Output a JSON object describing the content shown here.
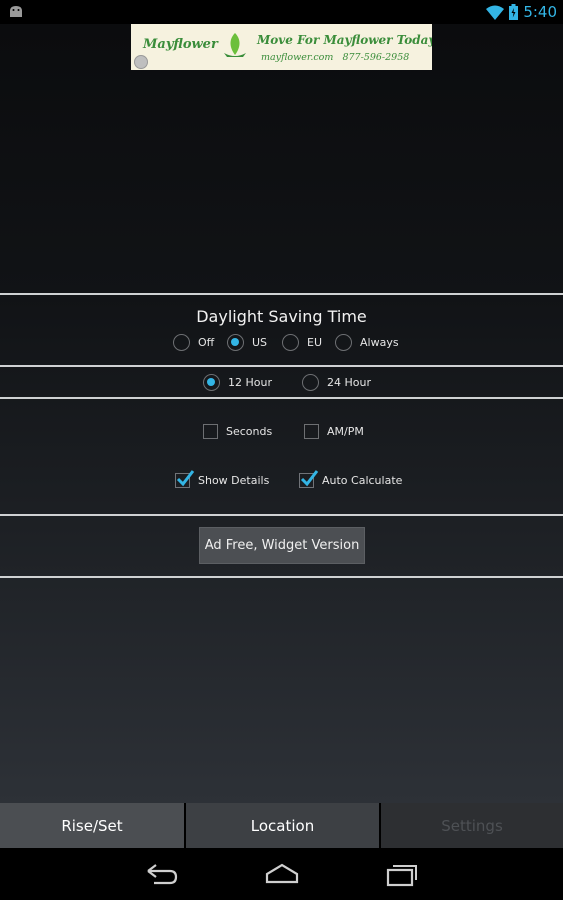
{
  "status_bar": {
    "time": "5:40",
    "icons": [
      "android-notification-icon",
      "wifi-icon",
      "battery-charging-icon"
    ]
  },
  "ad": {
    "brand": "Mayflower",
    "headline": "Move For Mayflower Today!",
    "url": "mayflower.com",
    "phone": "877-596-2958",
    "colors": {
      "background": "#f6f2df",
      "text": "#3a8d3a"
    }
  },
  "dst": {
    "title": "Daylight Saving Time",
    "options": [
      {
        "label": "Off",
        "selected": false
      },
      {
        "label": "US",
        "selected": true
      },
      {
        "label": "EU",
        "selected": false
      },
      {
        "label": "Always",
        "selected": false
      }
    ]
  },
  "time_format": {
    "options": [
      {
        "label": "12 Hour",
        "selected": true
      },
      {
        "label": "24 Hour",
        "selected": false
      }
    ]
  },
  "checkboxes": [
    {
      "label": "Seconds",
      "checked": false
    },
    {
      "label": "AM/PM",
      "checked": false
    },
    {
      "label": "Show Details",
      "checked": true
    },
    {
      "label": "Auto Calculate",
      "checked": true
    }
  ],
  "ad_free_button": {
    "label": "Ad Free, Widget Version"
  },
  "tabs": [
    {
      "label": "Rise/Set",
      "state": "inactive"
    },
    {
      "label": "Location",
      "state": "inactive"
    },
    {
      "label": "Settings",
      "state": "selected"
    }
  ],
  "nav": {
    "buttons": [
      "back-icon",
      "home-icon",
      "recent-apps-icon"
    ]
  },
  "colors": {
    "accent": "#33b5e5",
    "divider": "#cfd1d3"
  }
}
